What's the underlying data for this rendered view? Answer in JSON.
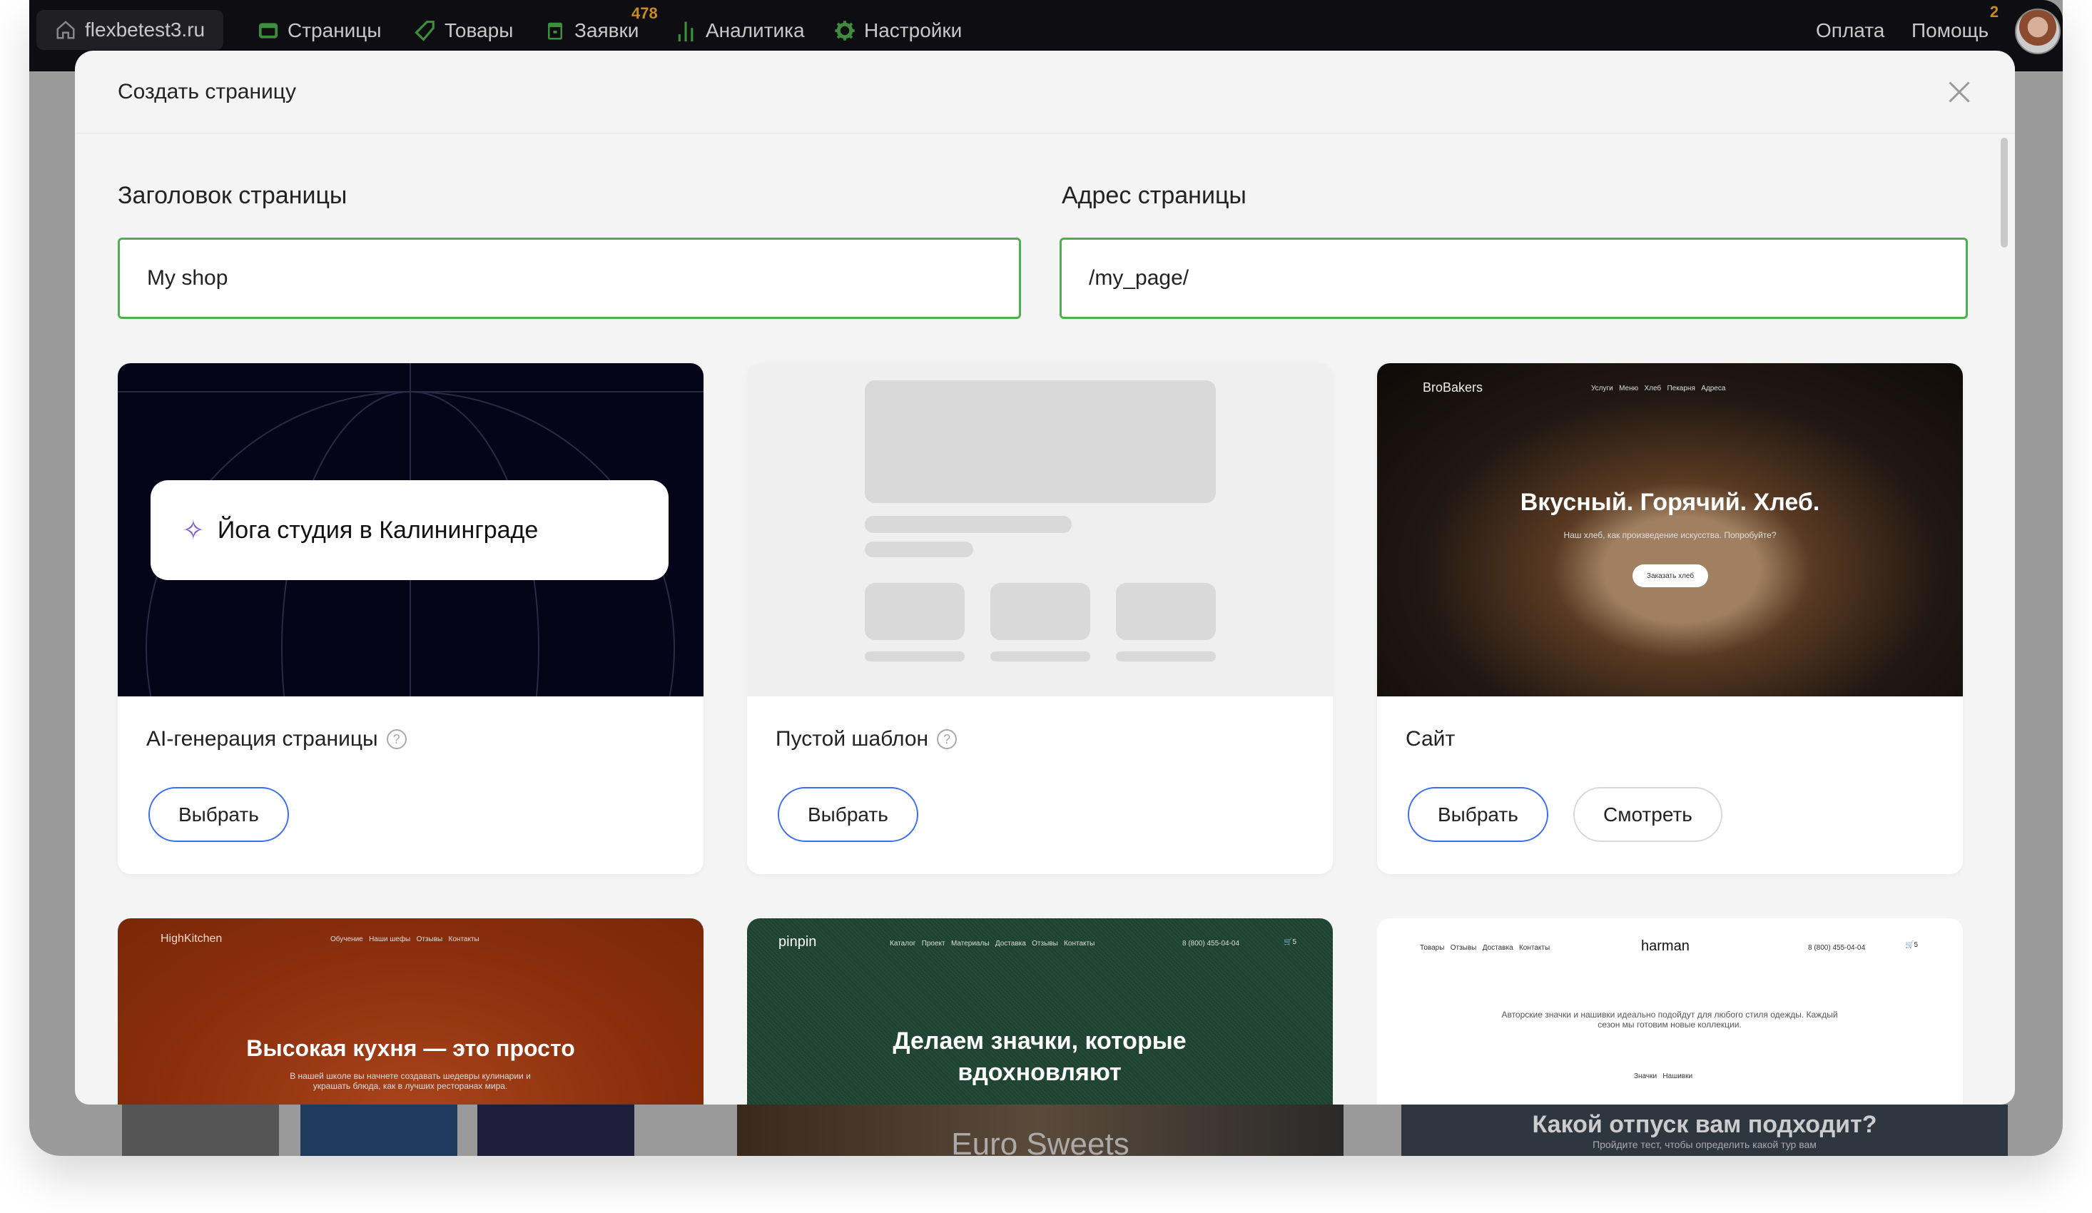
{
  "topbar": {
    "site": "flexbetest3.ru",
    "nav": [
      {
        "label": "Страницы",
        "icon": "browser-window-icon"
      },
      {
        "label": "Товары",
        "icon": "tag-icon"
      },
      {
        "label": "Заявки",
        "icon": "inbox-icon",
        "badge": "478"
      },
      {
        "label": "Аналитика",
        "icon": "bar-chart-icon"
      },
      {
        "label": "Настройки",
        "icon": "gear-icon"
      }
    ],
    "payment": "Оплата",
    "help": "Помощь",
    "help_badge": "2"
  },
  "colors": {
    "accent_green": "#4caf50",
    "button_blue": "#3d6df2",
    "badge_orange": "#c98a1e",
    "topbar": "#0e0e12"
  },
  "modal": {
    "title": "Создать страницу",
    "title_label": "Заголовок страницы",
    "title_value": "My shop",
    "address_label": "Адрес страницы",
    "address_value": "/my_page/",
    "cards": [
      {
        "title": "AI-генерация страницы",
        "preview_text": "Йога студия в Калининграде",
        "select": "Выбрать"
      },
      {
        "title": "Пустой шаблон",
        "select": "Выбрать"
      },
      {
        "title": "Сайт",
        "select": "Выбрать",
        "view": "Смотреть",
        "preview": {
          "logo": "BroBakers",
          "menu": "Услуги   Меню   Хлеб   Пекарня   Адреса",
          "headline": "Вкусный. Горячий. Хлеб.",
          "sub": "Наш хлеб, как произведение искусства. Попробуйте?",
          "cta": "Заказать хлеб"
        }
      }
    ],
    "row2": [
      {
        "logo": "HighKitchen",
        "menu": "Обучение   Наши шефы   Отзывы   Контакты",
        "headline": "Высокая кухня — это просто",
        "sub": "В нашей школе вы начнете создавать шедевры кулинарии и украшать блюда, как в лучших ресторанах мира."
      },
      {
        "logo": "pinpin",
        "menu": "Каталог   Проект   Материалы   Доставка   Отзывы   Контакты",
        "phone": "8 (800) 455-04-04",
        "cart": "5",
        "headline": "Делаем значки, которые вдохновляют"
      },
      {
        "logo": "harman",
        "menu": "Товары   Отзывы   Доставка   Контакты",
        "phone": "8 (800) 455-04-04",
        "cart": "5",
        "sub": "Авторские значки и нашивки идеально подойдут для любого стиля одежды. Каждый сезон мы готовим новые коллекции.",
        "tabs": "Значки   Нашивки"
      }
    ]
  },
  "background": {
    "sweets": "Euro Sweets",
    "vacation": "Какой отпуск вам подходит?",
    "vacation_sub": "Пройдите тест, чтобы определить какой тур вам"
  }
}
